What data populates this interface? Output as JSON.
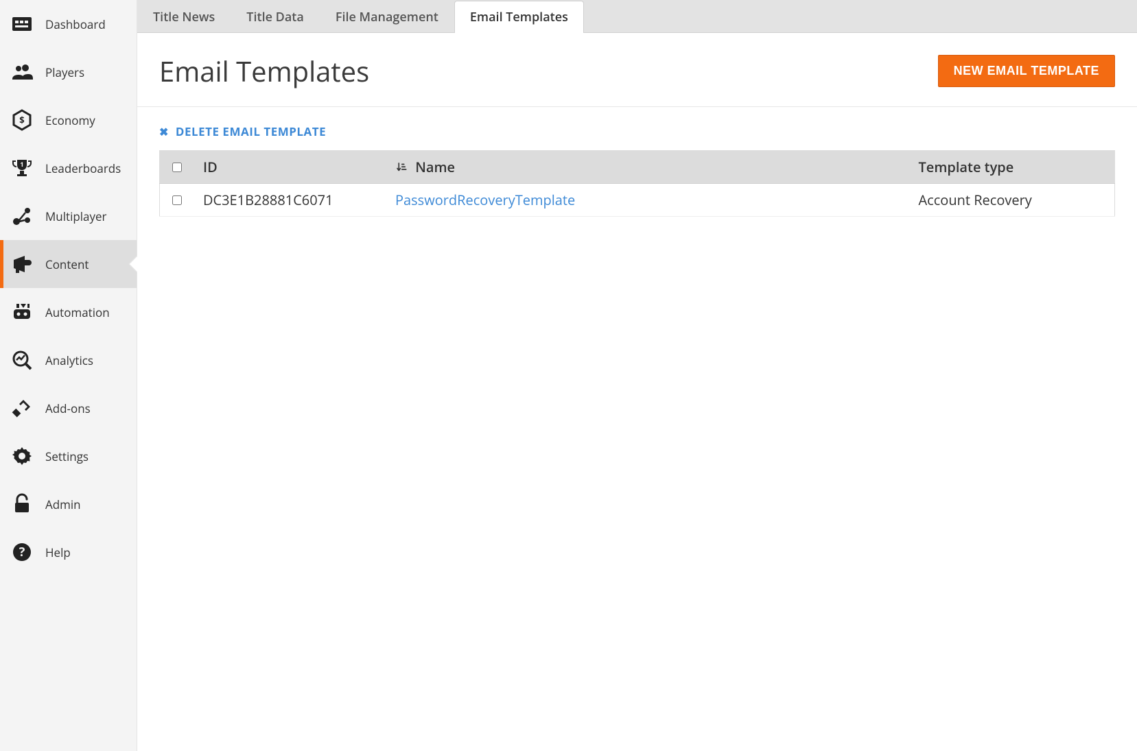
{
  "sidebar": {
    "items": [
      {
        "label": "Dashboard",
        "icon": "dashboard-icon"
      },
      {
        "label": "Players",
        "icon": "players-icon"
      },
      {
        "label": "Economy",
        "icon": "economy-icon"
      },
      {
        "label": "Leaderboards",
        "icon": "leaderboards-icon"
      },
      {
        "label": "Multiplayer",
        "icon": "multiplayer-icon"
      },
      {
        "label": "Content",
        "icon": "content-icon",
        "active": true
      },
      {
        "label": "Automation",
        "icon": "automation-icon"
      },
      {
        "label": "Analytics",
        "icon": "analytics-icon"
      },
      {
        "label": "Add-ons",
        "icon": "addons-icon"
      },
      {
        "label": "Settings",
        "icon": "settings-icon"
      },
      {
        "label": "Admin",
        "icon": "admin-icon"
      },
      {
        "label": "Help",
        "icon": "help-icon"
      }
    ]
  },
  "tabs": [
    {
      "label": "Title News"
    },
    {
      "label": "Title Data"
    },
    {
      "label": "File Management"
    },
    {
      "label": "Email Templates",
      "active": true
    }
  ],
  "header": {
    "title": "Email Templates",
    "new_button": "NEW EMAIL TEMPLATE"
  },
  "bulk_action": {
    "label": "DELETE EMAIL TEMPLATE"
  },
  "table": {
    "columns": {
      "id": "ID",
      "name": "Name",
      "type": "Template type"
    },
    "rows": [
      {
        "id": "DC3E1B28881C6071",
        "name": "PasswordRecoveryTemplate",
        "type": "Account Recovery"
      }
    ]
  }
}
